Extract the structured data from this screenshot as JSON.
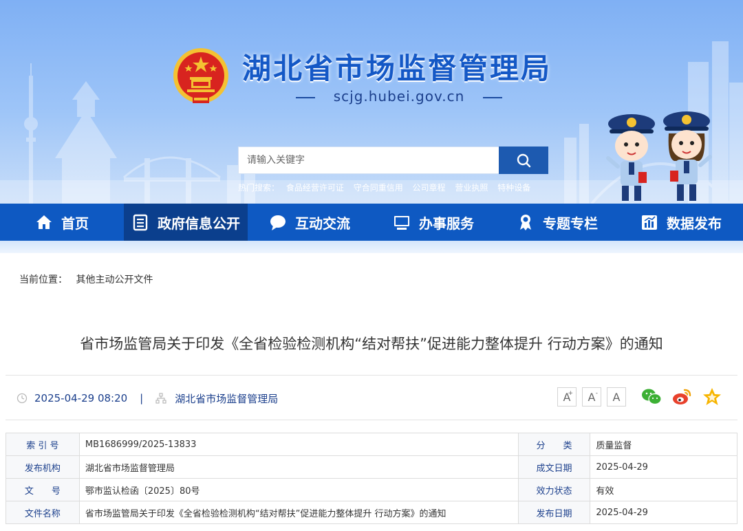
{
  "header": {
    "site_title": "湖北省市场监督管理局",
    "site_url": "scjg.hubei.gov.cn",
    "search": {
      "placeholder": "请输入关键字"
    },
    "hot_search_label": "热门搜索：",
    "hot_search_items": [
      "食品经营许可证",
      "守合同重信用",
      "公司章程",
      "营业执照",
      "特种设备"
    ]
  },
  "nav": {
    "items": [
      {
        "label": "首页",
        "icon": "home-icon"
      },
      {
        "label": "政府信息公开",
        "icon": "document-list-icon",
        "active": true
      },
      {
        "label": "互动交流",
        "icon": "chat-bubble-icon"
      },
      {
        "label": "办事服务",
        "icon": "monitor-icon"
      },
      {
        "label": "专题专栏",
        "icon": "badge-icon"
      },
      {
        "label": "数据发布",
        "icon": "bar-chart-icon"
      }
    ]
  },
  "breadcrumb": {
    "label": "当前位置：",
    "current": "其他主动公开文件"
  },
  "article": {
    "title": "省市场监管局关于印发《全省检验检测机构“结对帮扶”促进能力整体提升 行动方案》的通知",
    "datetime": "2025-04-29 08:20",
    "separator": "|",
    "publisher": "湖北省市场监督管理局",
    "font_controls": [
      "A",
      "A",
      "A"
    ],
    "share_icons": [
      "wechat-icon",
      "weibo-icon",
      "favorite-star-icon"
    ]
  },
  "info_table": {
    "rows": [
      {
        "label1": "索 引 号",
        "value1": "MB1686999/2025-13833",
        "label2": "分　　类",
        "value2": "质量监督"
      },
      {
        "label1": "发布机构",
        "value1": "湖北省市场监督管理局",
        "label2": "成文日期",
        "value2": "2025-04-29"
      },
      {
        "label1": "文　　号",
        "value1": "鄂市监认检函〔2025〕80号",
        "label2": "效力状态",
        "value2": "有效"
      },
      {
        "label1": "文件名称",
        "value1": "省市场监管局关于印发《全省检验检测机构“结对帮扶”促进能力整体提升 行动方案》的通知",
        "label2": "发布日期",
        "value2": "2025-04-29"
      }
    ]
  },
  "colors": {
    "nav_bg": "#0e59c2",
    "nav_active": "#0b3f8d",
    "title_blue": "#1458c6",
    "label_blue": "#1b3f8c"
  }
}
